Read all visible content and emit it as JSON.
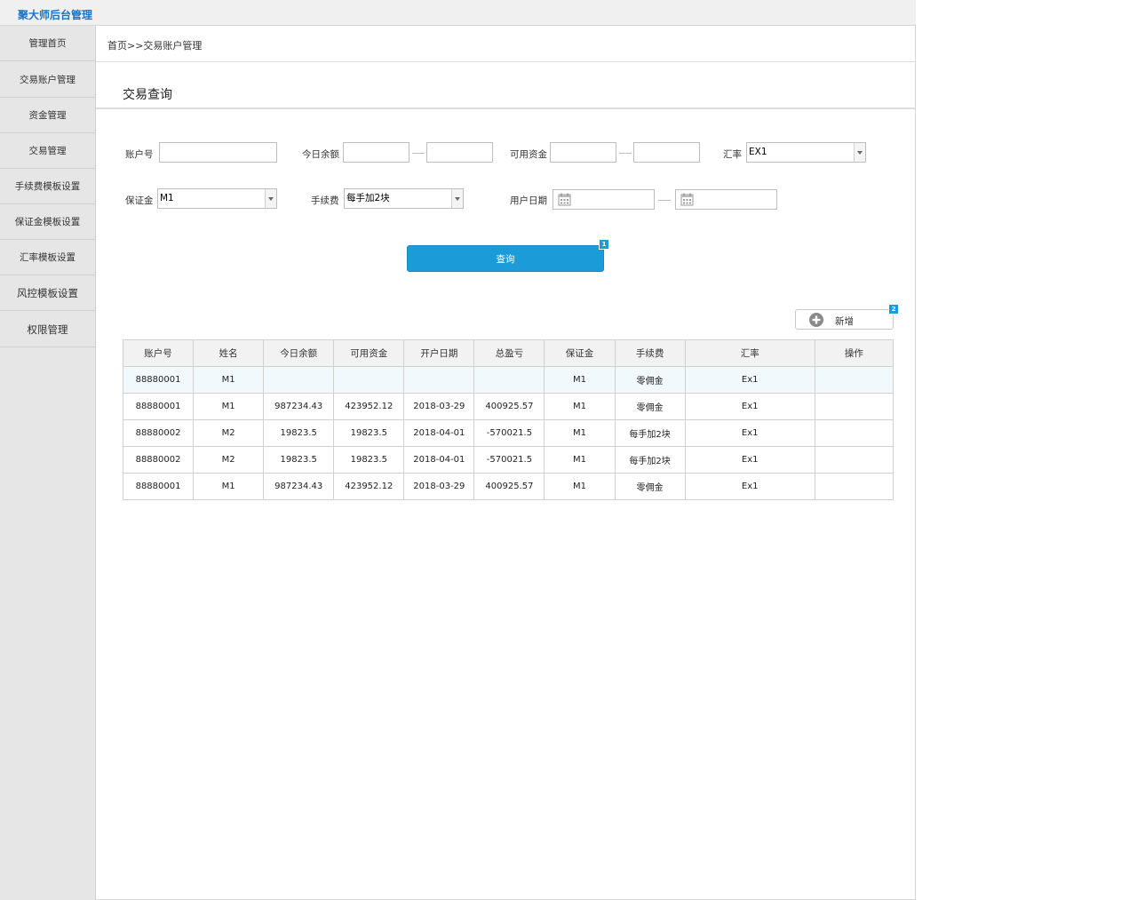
{
  "app": {
    "title": "聚大师后台管理"
  },
  "sidebar": {
    "items": [
      {
        "label": "管理首页"
      },
      {
        "label": "交易账户管理"
      },
      {
        "label": "资金管理"
      },
      {
        "label": "交易管理"
      },
      {
        "label": "手续费模板设置"
      },
      {
        "label": "保证金模板设置"
      },
      {
        "label": "汇率模板设置"
      },
      {
        "label": "风控模板设置"
      },
      {
        "label": "权限管理"
      }
    ]
  },
  "breadcrumb": "首页>>交易账户管理",
  "section_title": "交易查询",
  "filters": {
    "account_label": "账户号",
    "account_value": "",
    "balance_label": "今日余额",
    "balance_from": "",
    "balance_to": "",
    "available_label": "可用资金",
    "available_from": "",
    "available_to": "",
    "rate_label": "汇率",
    "rate_value": "EX1",
    "margin_label": "保证金",
    "margin_value": "M1",
    "fee_label": "手续费",
    "fee_value": "每手加2块",
    "date_label": "用户日期"
  },
  "query_button": {
    "label": "查询",
    "badge": "1"
  },
  "add_button": {
    "label": "新增",
    "badge": "2",
    "icon": "plus-circle-icon"
  },
  "table": {
    "headers": [
      "账户号",
      "姓名",
      "今日余额",
      "可用资金",
      "开户日期",
      "总盈亏",
      "保证金",
      "手续费",
      "汇率",
      "操作"
    ],
    "rows": [
      [
        "88880001",
        "M1",
        "",
        "",
        "",
        "",
        "M1",
        "零佣金",
        "Ex1",
        ""
      ],
      [
        "88880001",
        "M1",
        "987234.43",
        "423952.12",
        "2018-03-29",
        "400925.57",
        "M1",
        "零佣金",
        "Ex1",
        ""
      ],
      [
        "88880002",
        "M2",
        "19823.5",
        "19823.5",
        "2018-04-01",
        "-570021.5",
        "M1",
        "每手加2块",
        "Ex1",
        ""
      ],
      [
        "88880002",
        "M2",
        "19823.5",
        "19823.5",
        "2018-04-01",
        "-570021.5",
        "M1",
        "每手加2块",
        "Ex1",
        ""
      ],
      [
        "88880001",
        "M1",
        "987234.43",
        "423952.12",
        "2018-03-29",
        "400925.57",
        "M1",
        "零佣金",
        "Ex1",
        ""
      ]
    ]
  },
  "colors": {
    "accent": "#1b9bd7",
    "brand_title": "#1a73c9",
    "sidebar_bg": "#e6e6e6",
    "highlight_row": "#f2f9fd"
  }
}
